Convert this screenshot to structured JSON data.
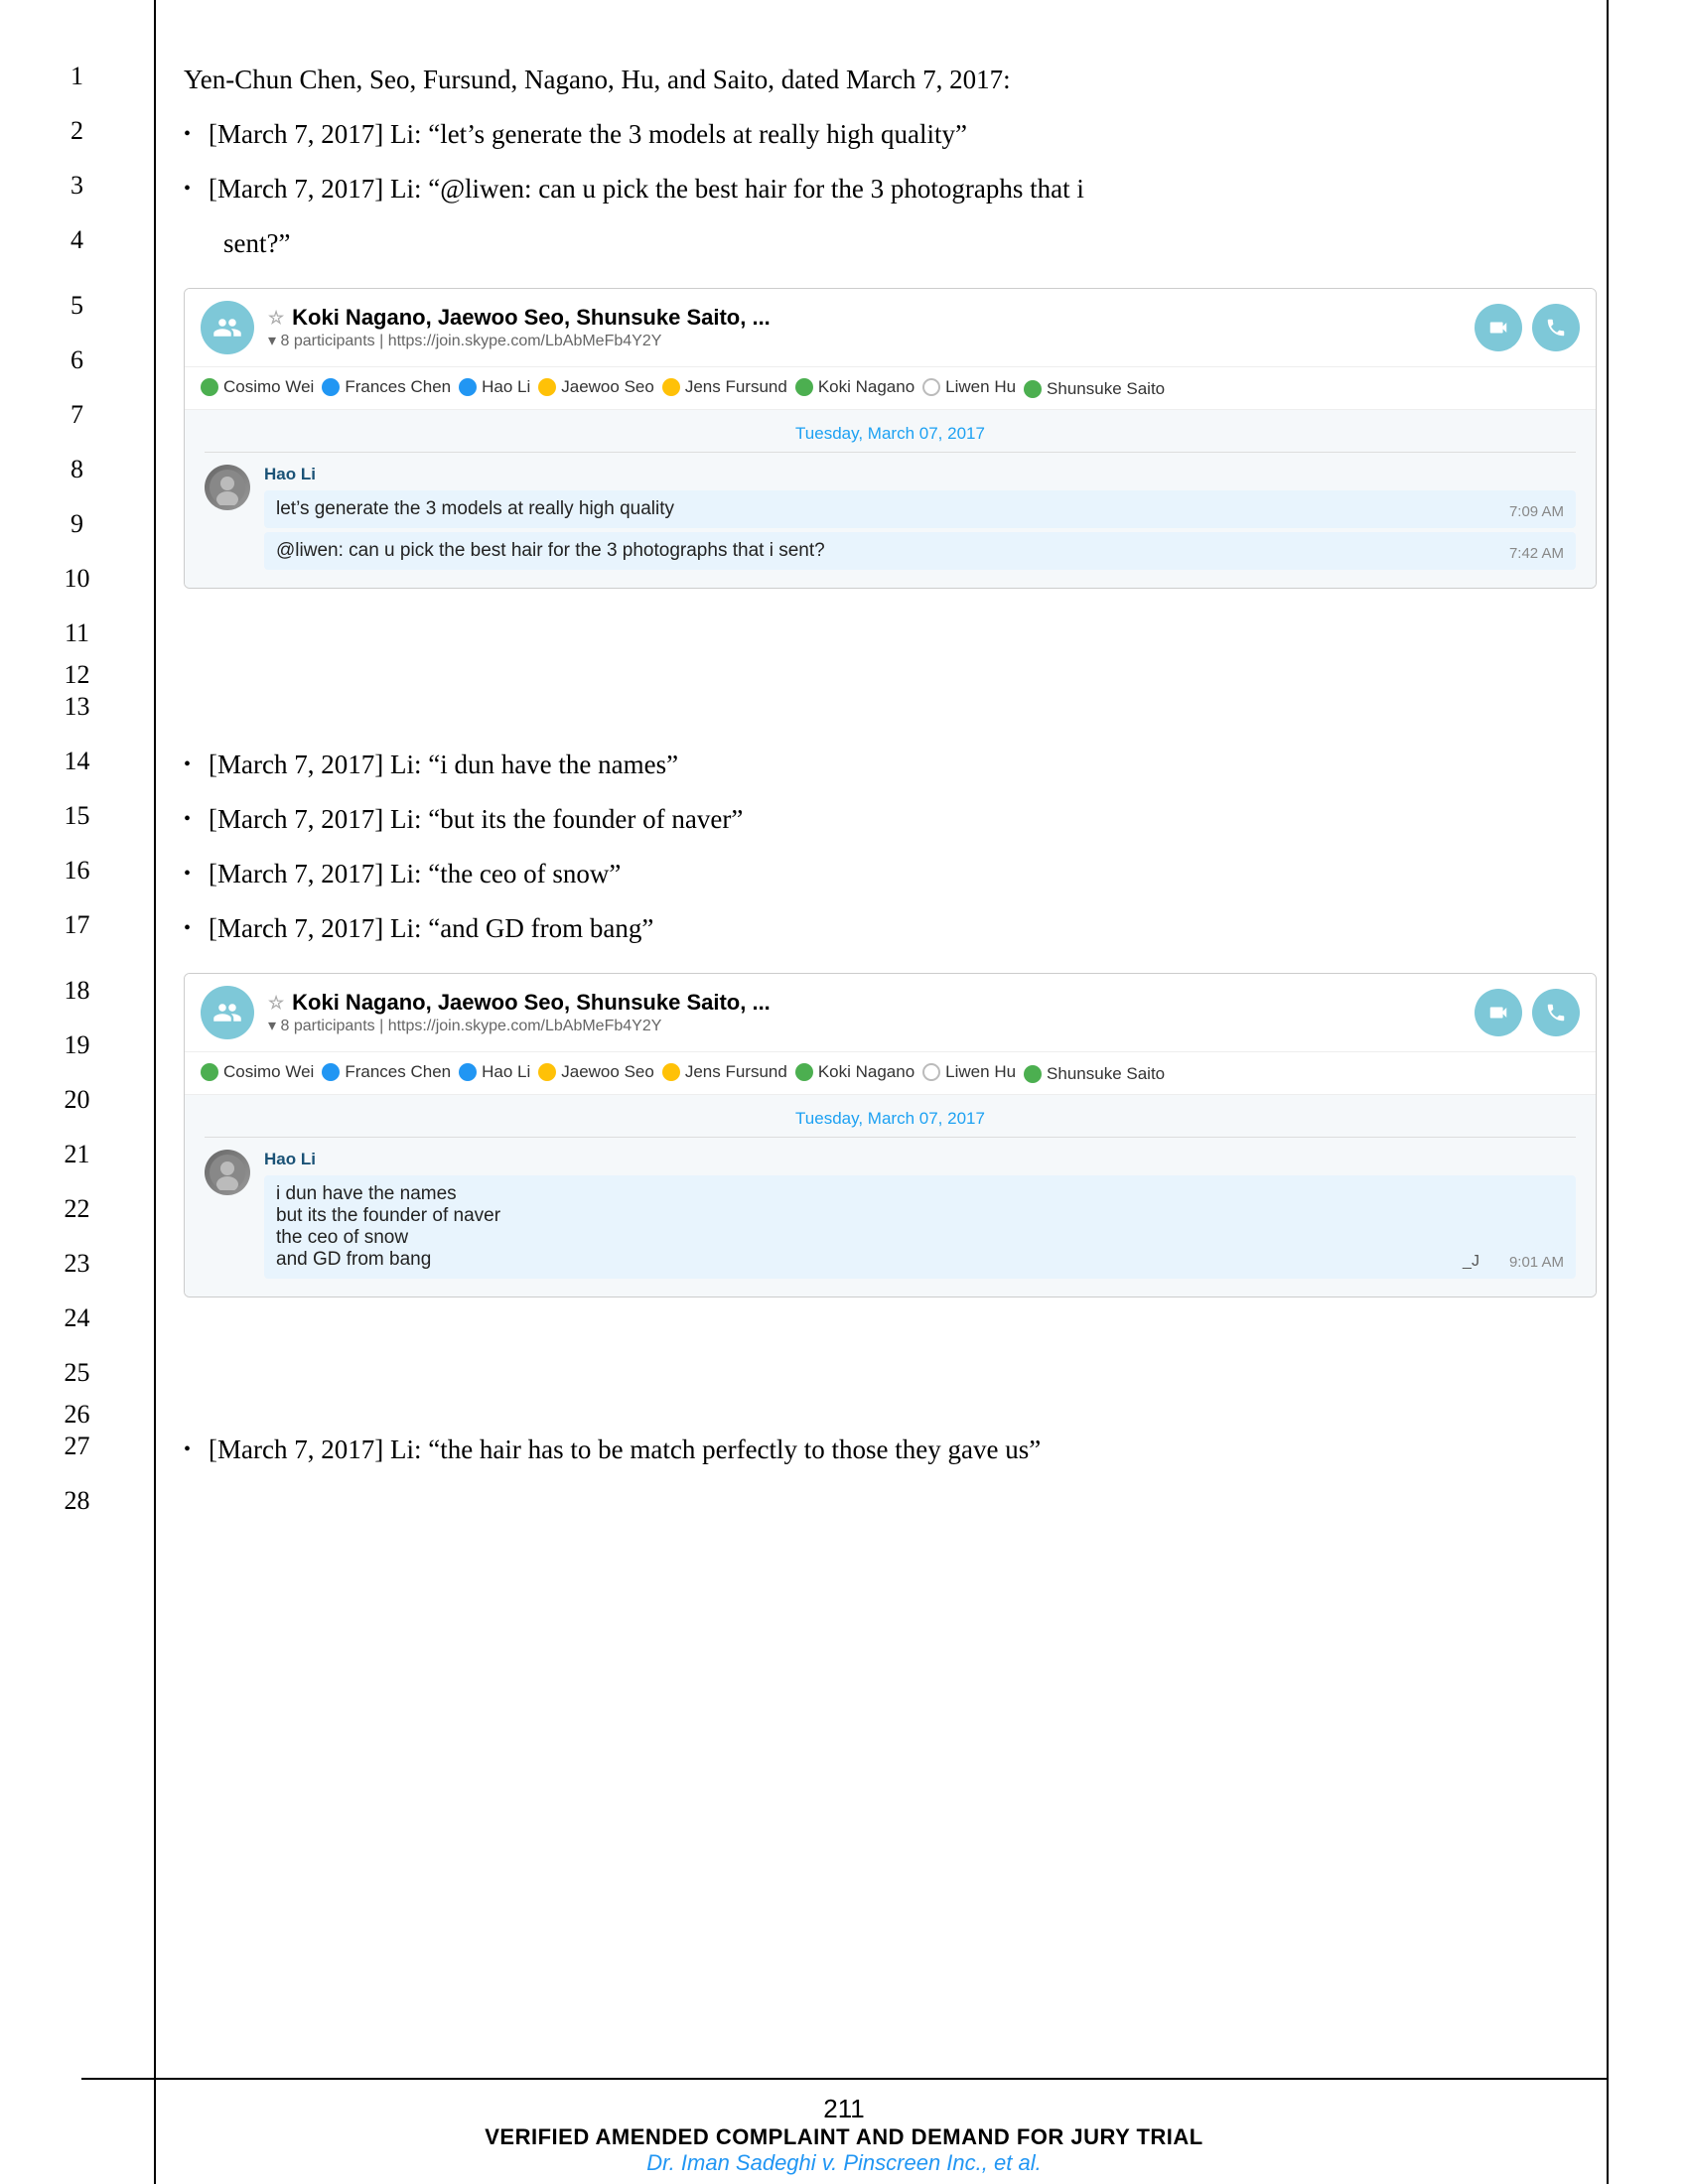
{
  "lines": [
    {
      "num": 1,
      "type": "text",
      "text": "Yen-Chun Chen, Seo, Fursund, Nagano, Hu, and Saito, dated March 7, 2017:"
    },
    {
      "num": 2,
      "type": "bullet",
      "text": "[March 7, 2017] Li: “let’s generate the 3 models at really high quality”"
    },
    {
      "num": 3,
      "type": "bullet",
      "text": "[March 7, 2017] Li: “@liwen: can u pick the best hair for the 3 photographs that i"
    },
    {
      "num": 4,
      "type": "continuation",
      "text": "sent?”"
    },
    {
      "num": "5-6",
      "type": "skype-box-1",
      "title": "Koki Nagano, Jaewoo Seo, Shunsuke Saito, ...",
      "subtitle": "8 participants  |  https://join.skype.com/LbAbMeFb4Y2Y",
      "participants": [
        {
          "name": "Cosimo Wei",
          "status": "green"
        },
        {
          "name": "Frances Chen",
          "status": "blue"
        },
        {
          "name": "Hao Li",
          "status": "blue"
        },
        {
          "name": "Jaewoo Seo",
          "status": "yellow"
        },
        {
          "name": "Jens Fursund",
          "status": "yellow"
        },
        {
          "name": "Koki Nagano",
          "status": "green"
        },
        {
          "name": "Liwen Hu",
          "status": "circle"
        },
        {
          "name": "Shunsuke Saito",
          "status": "green"
        }
      ],
      "date": "Tuesday, March 07, 2017",
      "sender": "Hao Li",
      "messages": [
        {
          "text": "let’s generate the 3 models at really high quality",
          "time": "7:09 AM"
        },
        {
          "text": "@liwen: can u pick the best hair for the 3 photographs that i sent?",
          "time": "7:42 AM"
        }
      ]
    },
    {
      "num": 14,
      "type": "bullet",
      "text": "[March 7, 2017] Li: “i dun have the names”"
    },
    {
      "num": 15,
      "type": "bullet",
      "text": "[March 7, 2017] Li: “but its the founder of naver”"
    },
    {
      "num": 16,
      "type": "bullet",
      "text": "[March 7, 2017] Li: “the ceo of snow”"
    },
    {
      "num": 17,
      "type": "bullet",
      "text": "[March 7, 2017] Li: “and GD from bang”"
    },
    {
      "num": "18-19",
      "type": "skype-box-2",
      "title": "Koki Nagano, Jaewoo Seo, Shunsuke Saito, ...",
      "subtitle": "8 participants  |  https://join.skype.com/LbAbMeFb4Y2Y",
      "participants": [
        {
          "name": "Cosimo Wei",
          "status": "green"
        },
        {
          "name": "Frances Chen",
          "status": "blue"
        },
        {
          "name": "Hao Li",
          "status": "blue"
        },
        {
          "name": "Jaewoo Seo",
          "status": "yellow"
        },
        {
          "name": "Jens Fursund",
          "status": "yellow"
        },
        {
          "name": "Koki Nagano",
          "status": "green"
        },
        {
          "name": "Liwen Hu",
          "status": "circle"
        },
        {
          "name": "Shunsuke Saito",
          "status": "green"
        }
      ],
      "date": "Tuesday, March 07, 2017",
      "sender": "Hao Li",
      "messages": [
        {
          "text": "i dun have the names",
          "time": ""
        },
        {
          "text": "but its the founder of naver",
          "time": ""
        },
        {
          "text": "the ceo of snow",
          "time": ""
        },
        {
          "text": "and GD from bang",
          "time": "9:01 AM"
        }
      ]
    },
    {
      "num": 27,
      "type": "bullet",
      "text": "[March 7, 2017] Li: “the hair has to be match perfectly to those they gave us”"
    }
  ],
  "footer": {
    "page_num": "211",
    "title": "VERIFIED AMENDED COMPLAINT AND DEMAND FOR JURY TRIAL",
    "subtitle": "Dr. Iman Sadeghi v. Pinscreen Inc., et al."
  },
  "line_numbers": [
    1,
    2,
    3,
    4,
    5,
    6,
    7,
    8,
    9,
    10,
    11,
    12,
    13,
    14,
    15,
    16,
    17,
    18,
    19,
    20,
    21,
    22,
    23,
    24,
    25,
    26,
    27,
    28
  ]
}
